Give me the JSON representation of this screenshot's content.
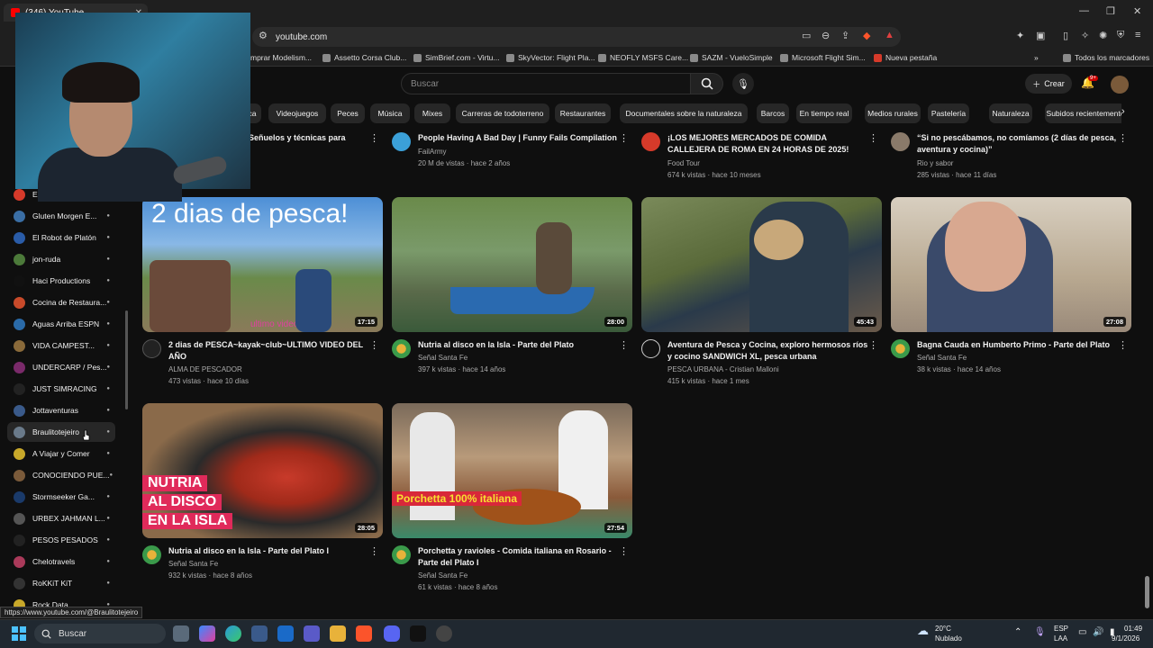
{
  "browser": {
    "tab_title": "(346) YouTube",
    "url": "youtube.com",
    "bookmarks": [
      {
        "label": "mprar Modelism..."
      },
      {
        "label": "Assetto Corsa Club..."
      },
      {
        "label": "SimBrief.com - Virtu..."
      },
      {
        "label": "SkyVector: Flight Pla..."
      },
      {
        "label": "NEOFLY MSFS Care..."
      },
      {
        "label": "SAZM - VueloSimple"
      },
      {
        "label": "Microsoft Flight Sim..."
      },
      {
        "label": "Nueva pestaña"
      },
      {
        "label": "Todos los marcadores"
      }
    ]
  },
  "header": {
    "search_placeholder": "Buscar",
    "create_label": "Crear",
    "notification_count": "9+"
  },
  "chips": [
    "ca",
    "Videojuegos",
    "Peces",
    "Música",
    "Mixes",
    "Carreras de todoterreno",
    "Restaurantes",
    "Documentales sobre la naturaleza",
    "Barcos",
    "En tiempo real",
    "Medios rurales",
    "Pastelería",
    "Naturaleza",
    "Subidos recientemente"
  ],
  "sidebar": {
    "items": [
      {
        "label": "Epicurious",
        "color": "#d63a2a"
      },
      {
        "label": "Gluten Morgen E...",
        "color": "#3a6ea5"
      },
      {
        "label": "El Robot de Platón",
        "color": "#2a5ca8"
      },
      {
        "label": "jon-ruda",
        "color": "#4c7a3a"
      },
      {
        "label": "Haci Productions",
        "color": "#111111"
      },
      {
        "label": "Cocina de Restaura...",
        "color": "#c84a2a"
      },
      {
        "label": "Aguas Arriba ESPN",
        "color": "#2a6aa8"
      },
      {
        "label": "VIDA CAMPEST...",
        "color": "#8a6a3a"
      },
      {
        "label": "UNDERCARP / Pes...",
        "color": "#7a2a6a"
      },
      {
        "label": "JUST SIMRACING",
        "color": "#222222"
      },
      {
        "label": "Jottaventuras",
        "color": "#3a5a8a"
      },
      {
        "label": "Braulitotejeiro",
        "color": "#6a7a8a"
      },
      {
        "label": "A Viajar y Comer",
        "color": "#c8a82a"
      },
      {
        "label": "CONOCIENDO PUE...",
        "color": "#7a5a3a"
      },
      {
        "label": "Stormseeker Ga...",
        "color": "#1a3a6a"
      },
      {
        "label": "URBEX JAHMAN L...",
        "color": "#555555"
      },
      {
        "label": "PESOS PESADOS",
        "color": "#222222"
      },
      {
        "label": "Chelotravels",
        "color": "#aa3a5a"
      },
      {
        "label": "RoKKiT KiT",
        "color": "#333333"
      },
      {
        "label": "Rock Data",
        "color": "#c8a82a"
      }
    ]
  },
  "top_row": [
    {
      "title": "Señuelos y técnicas para",
      "channel": "",
      "meta": ""
    },
    {
      "title": "People Having A Bad Day | Funny Fails Compilation",
      "channel": "FailArmy",
      "meta": "20 M de vistas · hace 2 años"
    },
    {
      "title": "¡LOS MEJORES MERCADOS DE COMIDA CALLEJERA DE ROMA EN 24 HORAS DE 2025!",
      "channel": "Food Tour",
      "meta": "674 k vistas · hace 10 meses"
    },
    {
      "title": "“Si no pescábamos, no comíamos (2 días de pesca, aventura y cocina)”",
      "channel": "Rio y sabor",
      "meta": "285 vistas · hace 11 días"
    }
  ],
  "videos": [
    {
      "title": "2 dias de PESCA~kayak~club~ULTIMO VIDEO DEL AÑO",
      "channel": "ALMA DE PESCADOR",
      "meta": "473 vistas · hace 10 días",
      "duration": "17:15",
      "thumb_text": "2 dias de pesca!",
      "thumb_sub": "ultimo video del año"
    },
    {
      "title": "Nutria al disco en la Isla - Parte del Plato",
      "channel": "Señal Santa Fe",
      "meta": "397 k vistas · hace 14 años",
      "duration": "28:00"
    },
    {
      "title": "Aventura de Pesca y Cocina, exploro hermosos ríos y cocino SANDWICH XL, pesca urbana",
      "channel": "PESCA URBANA - Cristian Malloni",
      "meta": "415 k vistas · hace 1 mes",
      "duration": "45:43"
    },
    {
      "title": "Bagna Cauda en Humberto Primo - Parte del Plato",
      "channel": "Señal Santa Fe",
      "meta": "38 k vistas · hace 14 años",
      "duration": "27:08"
    },
    {
      "title": "Nutria al disco en la Isla - Parte del Plato I",
      "channel": "Señal Santa Fe",
      "meta": "932 k vistas · hace 8 años",
      "duration": "28:05",
      "thumb_text1": "NUTRIA",
      "thumb_text2": "AL DISCO",
      "thumb_text3": "EN LA ISLA"
    },
    {
      "title": "Porchetta y ravioles - Comida italiana en Rosario - Parte del Plato I",
      "channel": "Señal Santa Fe",
      "meta": "61 k vistas · hace 8 años",
      "duration": "27:54",
      "thumb_text": "Porchetta 100% italiana"
    }
  ],
  "status_url": "https://www.youtube.com/@Braulitotejeiro",
  "taskbar": {
    "search_label": "Buscar",
    "weather_temp": "20°C",
    "weather_desc": "Nublado",
    "lang1": "ESP",
    "lang2": "LAA",
    "time": "01:49",
    "date": "9/1/2026"
  }
}
